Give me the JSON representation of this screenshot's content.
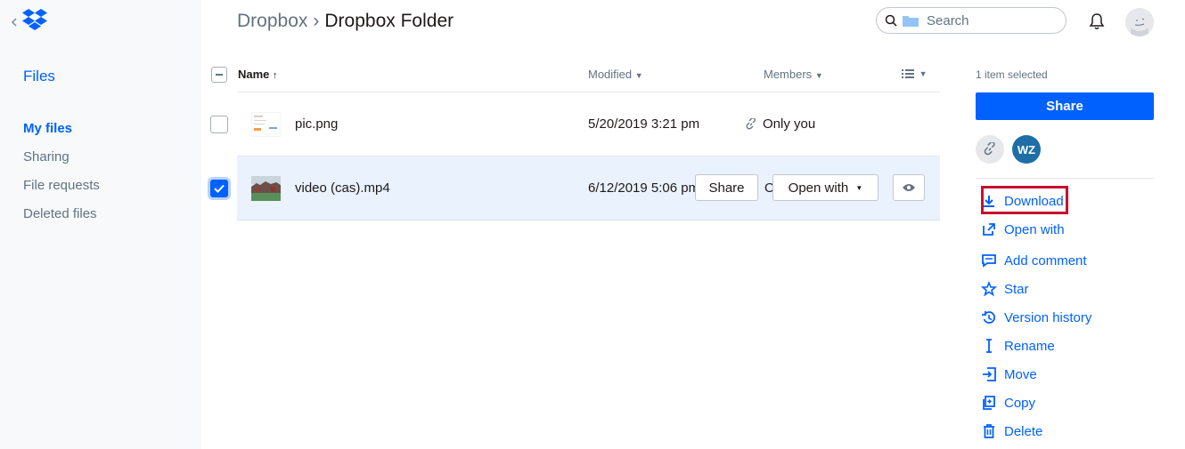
{
  "sidebar": {
    "title": "Files",
    "items": [
      {
        "label": "My files",
        "active": true
      },
      {
        "label": "Sharing"
      },
      {
        "label": "File requests"
      },
      {
        "label": "Deleted files"
      }
    ]
  },
  "header": {
    "breadcrumb_root": "Dropbox",
    "breadcrumb_current": "Dropbox Folder",
    "search_placeholder": "Search"
  },
  "table": {
    "columns": {
      "name": "Name",
      "modified": "Modified",
      "members": "Members"
    },
    "rows": [
      {
        "name": "pic.png",
        "modified": "5/20/2019 3:21 pm",
        "members": "Only you",
        "selected": false
      },
      {
        "name": "video (cas).mp4",
        "modified": "6/12/2019 5:06 pm",
        "members": "Only you",
        "selected": true,
        "share_label": "Share",
        "open_with_label": "Open with"
      }
    ]
  },
  "panel": {
    "selection_text": "1 item selected",
    "share_label": "Share",
    "member_initials": "WZ",
    "actions": [
      {
        "label": "Download",
        "icon": "download-icon"
      },
      {
        "label": "Open with",
        "icon": "open-with-icon"
      },
      {
        "label": "Add comment",
        "icon": "comment-icon"
      },
      {
        "label": "Star",
        "icon": "star-icon"
      },
      {
        "label": "Version history",
        "icon": "history-icon"
      },
      {
        "label": "Rename",
        "icon": "rename-icon"
      },
      {
        "label": "Move",
        "icon": "move-icon"
      },
      {
        "label": "Copy",
        "icon": "copy-icon"
      },
      {
        "label": "Delete",
        "icon": "trash-icon"
      }
    ]
  },
  "colors": {
    "accent": "#0061fe",
    "highlight": "#c8102e",
    "selected_row": "#e9f2fd"
  }
}
